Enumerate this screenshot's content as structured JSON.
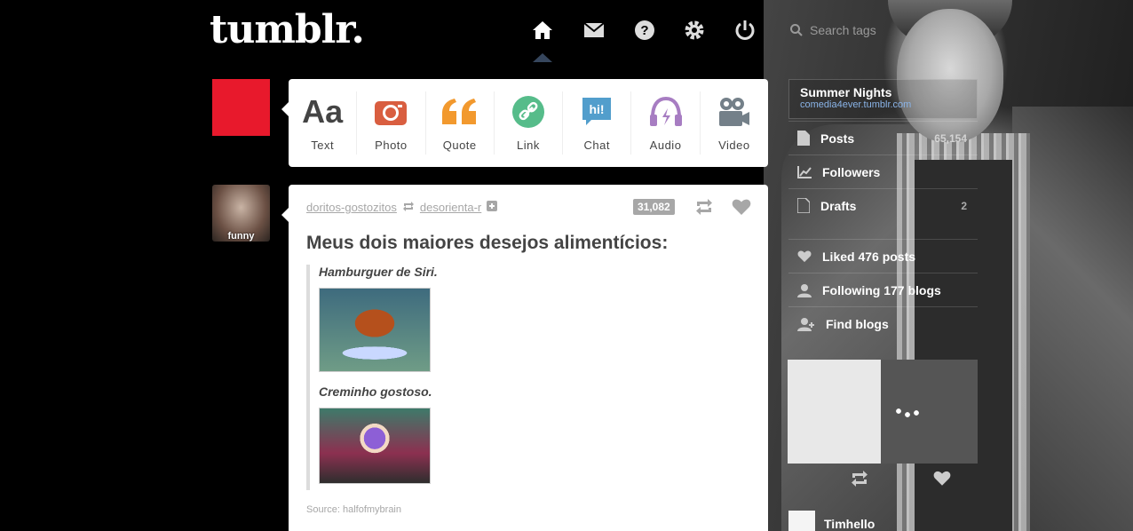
{
  "header": {
    "logo": "tumblr.",
    "nav": [
      "home-icon",
      "mail-icon",
      "help-icon",
      "settings-icon",
      "power-icon"
    ],
    "search_placeholder": "Search tags"
  },
  "post_types": [
    {
      "label": "Text",
      "icon": "text-icon",
      "color": "#444444"
    },
    {
      "label": "Photo",
      "icon": "camera-icon",
      "color": "#d95e40"
    },
    {
      "label": "Quote",
      "icon": "quote-icon",
      "color": "#f2992e"
    },
    {
      "label": "Link",
      "icon": "link-icon",
      "color": "#56bc8a"
    },
    {
      "label": "Chat",
      "icon": "chat-icon",
      "color": "#529ecc"
    },
    {
      "label": "Audio",
      "icon": "headphones-icon",
      "color": "#a77dc2"
    },
    {
      "label": "Video",
      "icon": "video-camera-icon",
      "color": "#748089"
    }
  ],
  "post": {
    "avatar_label": "funny",
    "author": "doritos-gostozitos",
    "reblogged_from": "desorienta-r",
    "notes": "31,082",
    "title": "Meus dois maiores desejos alimentícios:",
    "quote1": "Hamburguer de Siri.",
    "quote2": "Creminho gostoso.",
    "source": "Source: halfofmybrain"
  },
  "sidebar": {
    "blog_name": "Summer Nights",
    "blog_url": "comedia4ever.tumblr.com",
    "items": [
      {
        "label": "Posts",
        "value": "65,154"
      },
      {
        "label": "Followers",
        "value": ""
      },
      {
        "label": "Drafts",
        "value": "2"
      },
      {
        "label": "Liked 476 posts",
        "value": ""
      },
      {
        "label": "Following 177 blogs",
        "value": ""
      },
      {
        "label": "Find blogs",
        "value": ""
      }
    ],
    "radar_user": "Timhello"
  },
  "colors": {
    "brand_red": "#e8192c",
    "nav_caret": "#36465d"
  }
}
